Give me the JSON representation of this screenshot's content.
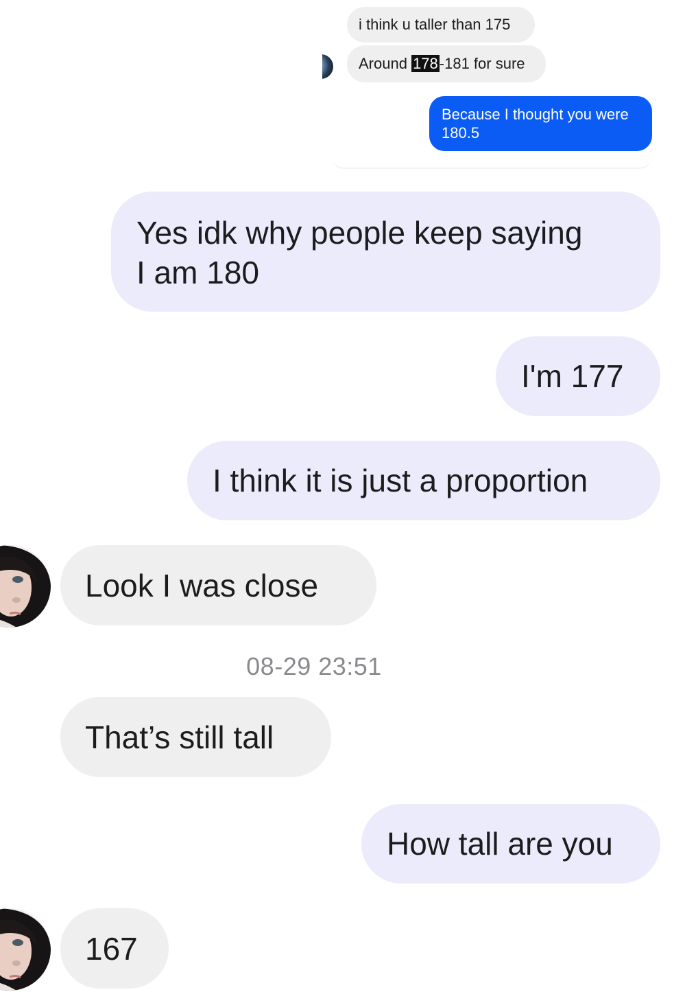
{
  "quoted": {
    "messages": [
      {
        "text": "i think u taller than 175"
      },
      {
        "before": "Around ",
        "highlight": "178",
        "after": "-181 for sure"
      }
    ],
    "reply": {
      "line1": "Because I thought you were",
      "line2": "180.5"
    }
  },
  "messages": [
    {
      "from": "me",
      "line1": "Yes idk why people keep saying",
      "line2": "I am 180"
    },
    {
      "from": "me",
      "text": "I'm 177"
    },
    {
      "from": "me",
      "text": "I think it is just a proportion"
    },
    {
      "from": "them",
      "text": "Look I was close"
    },
    {
      "from": "them",
      "text": "That’s still tall"
    },
    {
      "from": "me",
      "text": "How tall are you"
    },
    {
      "from": "them",
      "text": "167"
    }
  ],
  "timestamp": "08-29 23:51",
  "colors": {
    "sent_bubble": "#ebebfb",
    "received_bubble": "#efefef",
    "quoted_sent_bubble": "#0a5cf5",
    "timestamp_text": "#8a8a8e"
  },
  "icons": {
    "contact_avatar": "avatar-icon"
  }
}
